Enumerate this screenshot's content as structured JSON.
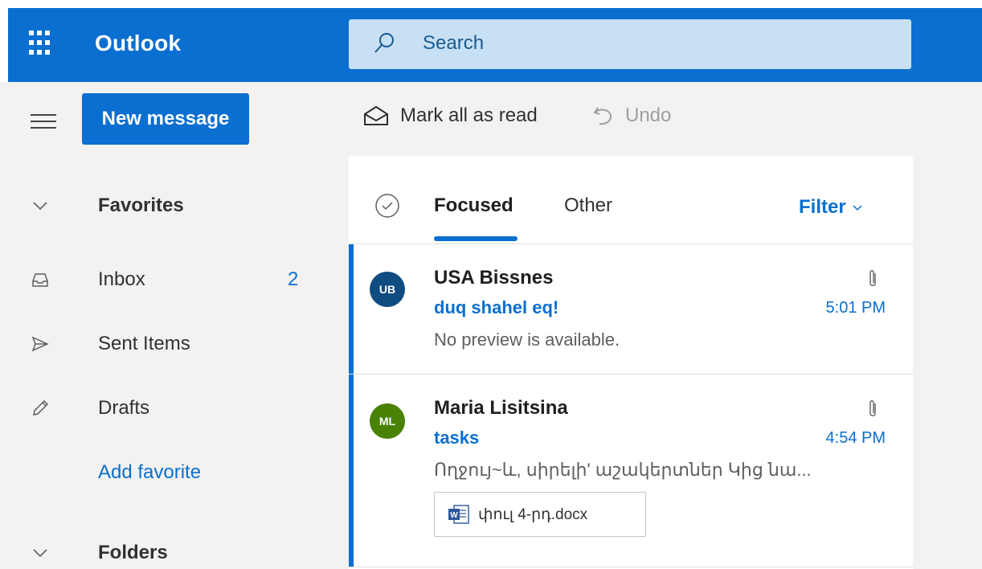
{
  "app": {
    "title": "Outlook"
  },
  "search": {
    "placeholder": "Search"
  },
  "toolbar": {
    "new_message": "New message",
    "mark_all_read": "Mark all as read",
    "undo": "Undo"
  },
  "nav": {
    "favorites": "Favorites",
    "items": [
      {
        "label": "Inbox",
        "count": "2",
        "icon": "inbox-icon"
      },
      {
        "label": "Sent Items",
        "icon": "send-icon"
      },
      {
        "label": "Drafts",
        "icon": "pencil-icon"
      }
    ],
    "add_favorite": "Add favorite",
    "folders": "Folders"
  },
  "list": {
    "tabs": [
      {
        "label": "Focused",
        "selected": true
      },
      {
        "label": "Other"
      }
    ],
    "filter": "Filter",
    "messages": [
      {
        "initials": "UB",
        "avatar_color": "#0f4c81",
        "sender": "USA Bissnes",
        "subject": "duq shahel eq!",
        "time": "5:01 PM",
        "preview": "No preview is available.",
        "has_attachment": true
      },
      {
        "initials": "ML",
        "avatar_color": "#498205",
        "sender": "Maria Lisitsina",
        "subject": "tasks",
        "time": "4:54 PM",
        "preview": "Ողջույ~և, սիրելի' աշակերտներ Կից նա...",
        "has_attachment": true,
        "attachment_name": "փուլ 4-րդ.docx"
      }
    ]
  },
  "colors": {
    "brand": "#0a6fd0",
    "search_bg": "#c7e0f4",
    "pane_bg": "#f3f2f1"
  }
}
